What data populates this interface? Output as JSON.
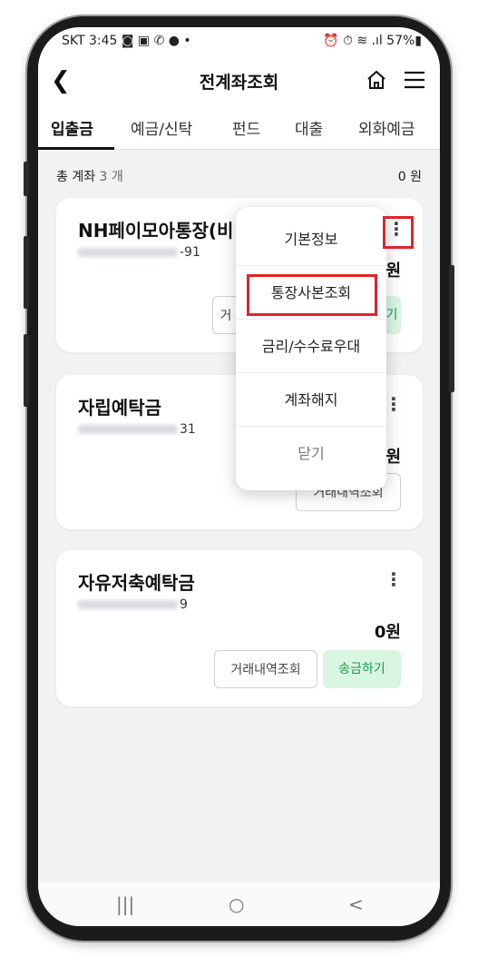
{
  "status": {
    "left": "SKT 3:45 ◙ ▣ ✆ ● •",
    "right": "⏰ ⏱ ≋ .ıl 57%▮"
  },
  "appbar": {
    "title": "전계좌조회"
  },
  "tabs": [
    "입출금",
    "예금/신탁",
    "펀드",
    "대출",
    "외화예금"
  ],
  "summary": {
    "label": "총 계좌",
    "count": "3 개",
    "amount": "0 원"
  },
  "accounts": [
    {
      "name": "NH페이모아통장(비",
      "num_suffix": "-91",
      "balance": "원",
      "btn_history": "거",
      "btn_send": "기"
    },
    {
      "name": "자립예탁금",
      "num_suffix": "31",
      "balance": "원",
      "btn_history": "거래내역조회"
    },
    {
      "name": "자유저축예탁금",
      "num_suffix": "9",
      "balance": "0원",
      "btn_history": "거래내역조회",
      "btn_send": "송금하기"
    }
  ],
  "popup": {
    "items": [
      "기본정보",
      "통장사본조회",
      "금리/수수료우대",
      "계좌해지",
      "닫기"
    ]
  },
  "colors": {
    "highlight": "#e0242a",
    "accent_green": "#1a9b4a"
  },
  "icons": {
    "back": "chevron-left-icon",
    "home": "home-icon",
    "menu": "hamburger-menu-icon",
    "more": "kebab-icon"
  },
  "navbar": {
    "recent": "|||",
    "home": "○",
    "back": "<"
  }
}
